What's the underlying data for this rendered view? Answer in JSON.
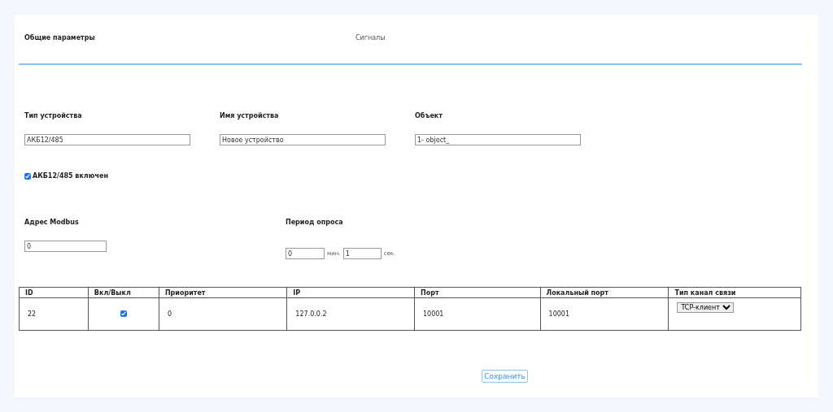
{
  "tabs": [
    {
      "label": "Общие параметры",
      "selected": true
    },
    {
      "label": "Сигналы",
      "selected": false
    }
  ],
  "fields": [
    {
      "label": "Тип устройства",
      "value": "АКБ12/485"
    },
    {
      "label": "Имя устройства",
      "value": "Новое устройство"
    },
    {
      "label": "Объект",
      "value": "1- object_"
    }
  ],
  "enabled": {
    "label": "АКБ12/485 включен",
    "checked": true
  },
  "modbus": {
    "label": "Адрес Modbus",
    "value": "0"
  },
  "period": {
    "label": "Период опроса",
    "minutes": "0",
    "minutes_unit": "мин.",
    "seconds": "1",
    "seconds_unit": "сек."
  },
  "table": {
    "columns": [
      "ID",
      "Вкл/Выкл",
      "Приоритет",
      "IP",
      "Порт",
      "Локальный порт",
      "Тип канал связи"
    ],
    "rows": [
      {
        "id": "22",
        "enabled": true,
        "priority": "0",
        "ip": "127.0.0.2",
        "port": "10001",
        "local_port": "10001",
        "channel_type": "TCP-клиент"
      }
    ]
  },
  "save_button": "Сохранить"
}
